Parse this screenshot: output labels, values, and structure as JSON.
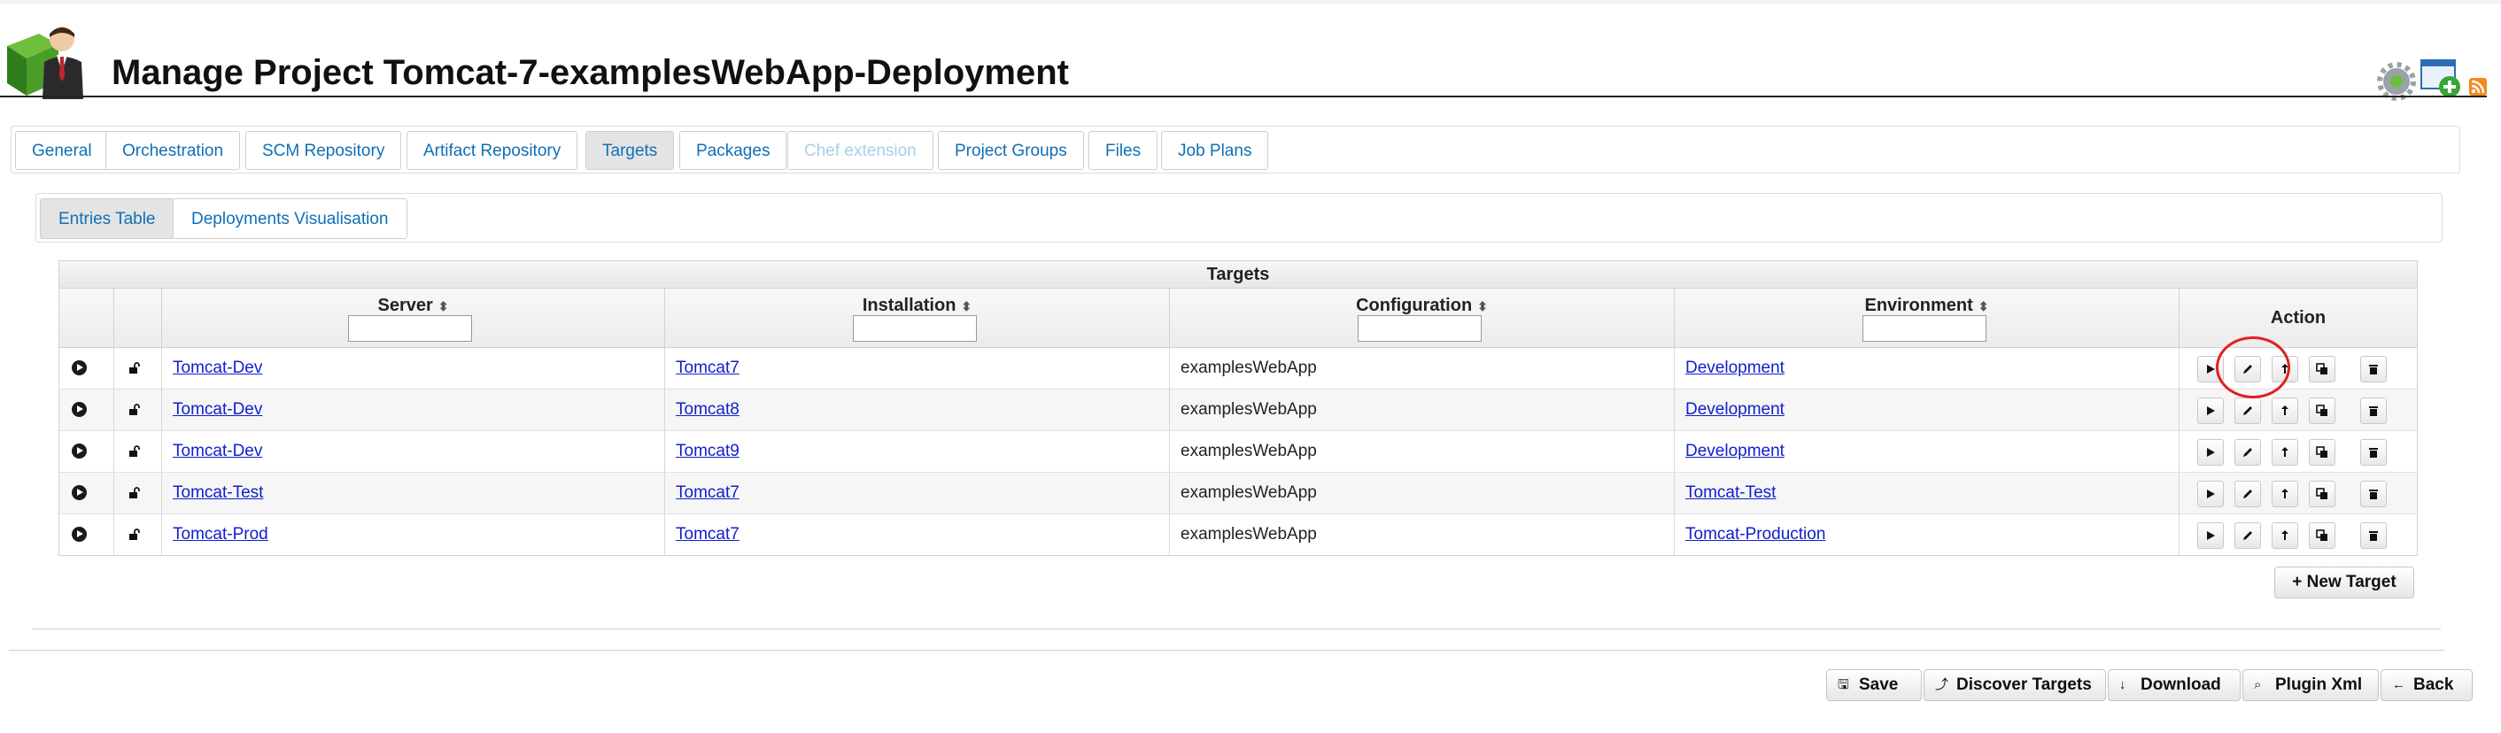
{
  "header": {
    "title": "Manage Project Tomcat-7-examplesWebApp-Deployment",
    "logo_icon": "user-cube-icon",
    "right_icons": [
      "settings-gear-icon",
      "add-window-icon",
      "rss-icon"
    ]
  },
  "tabs": [
    {
      "label": "General",
      "state": "normal"
    },
    {
      "label": "Orchestration",
      "state": "normal"
    },
    {
      "label": "SCM Repository",
      "state": "normal"
    },
    {
      "label": "Artifact Repository",
      "state": "normal"
    },
    {
      "label": "Targets",
      "state": "active"
    },
    {
      "label": "Packages",
      "state": "normal"
    },
    {
      "label": "Chef extension",
      "state": "disabled"
    },
    {
      "label": "Project Groups",
      "state": "normal"
    },
    {
      "label": "Files",
      "state": "normal"
    },
    {
      "label": "Job Plans",
      "state": "normal"
    }
  ],
  "subtabs": [
    {
      "label": "Entries Table",
      "state": "active"
    },
    {
      "label": "Deployments Visualisation",
      "state": "normal"
    }
  ],
  "table": {
    "caption": "Targets",
    "columns": {
      "server": "Server",
      "installation": "Installation",
      "configuration": "Configuration",
      "environment": "Environment",
      "action": "Action"
    },
    "sort_glyph": "⬍",
    "rows": [
      {
        "server": "Tomcat-Dev",
        "installation": "Tomcat7",
        "configuration": "examplesWebApp",
        "environment": "Development"
      },
      {
        "server": "Tomcat-Dev",
        "installation": "Tomcat8",
        "configuration": "examplesWebApp",
        "environment": "Development"
      },
      {
        "server": "Tomcat-Dev",
        "installation": "Tomcat9",
        "configuration": "examplesWebApp",
        "environment": "Development"
      },
      {
        "server": "Tomcat-Test",
        "installation": "Tomcat7",
        "configuration": "examplesWebApp",
        "environment": "Tomcat-Test"
      },
      {
        "server": "Tomcat-Prod",
        "installation": "Tomcat7",
        "configuration": "examplesWebApp",
        "environment": "Tomcat-Production"
      }
    ],
    "action_icons": [
      "play-icon",
      "edit-icon",
      "deploy-icon",
      "copy-icon",
      "delete-icon"
    ]
  },
  "new_target_label": "+ New Target",
  "footer": {
    "save": "Save",
    "discover": "Discover Targets",
    "download": "Download",
    "plugin_xml": "Plugin Xml",
    "back": "Back"
  },
  "colors": {
    "link": "#1020cc",
    "tab_text": "#0f6fb6",
    "highlight": "#e02020"
  }
}
